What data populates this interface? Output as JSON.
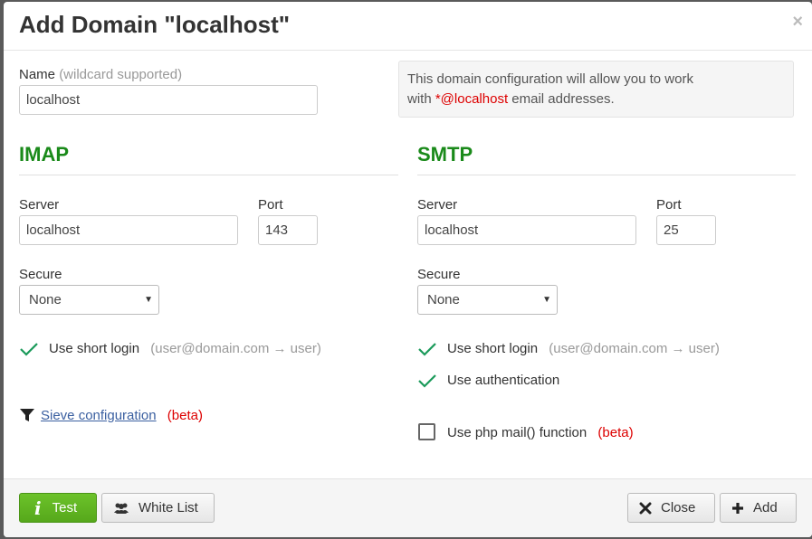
{
  "dialog": {
    "title": "Add Domain \"localhost\"",
    "close_symbol": "×"
  },
  "name_field": {
    "label": "Name",
    "hint": "(wildcard supported)",
    "value": "localhost"
  },
  "info": {
    "line1": "This domain configuration will allow you to work",
    "line2_prefix": "with ",
    "highlight": "*@localhost",
    "line2_suffix": " email addresses."
  },
  "imap": {
    "heading": "IMAP",
    "server_label": "Server",
    "server_value": "localhost",
    "port_label": "Port",
    "port_value": "143",
    "secure_label": "Secure",
    "secure_value": "None",
    "short_login_label": "Use short login",
    "short_login_hint": "(user@domain.com → user)",
    "sieve_link": "Sieve configuration",
    "sieve_beta": "(beta)"
  },
  "smtp": {
    "heading": "SMTP",
    "server_label": "Server",
    "server_value": "localhost",
    "port_label": "Port",
    "port_value": "25",
    "secure_label": "Secure",
    "secure_value": "None",
    "short_login_label": "Use short login",
    "short_login_hint": "(user@domain.com → user)",
    "auth_label": "Use authentication",
    "php_mail_label": "Use php mail() function",
    "php_mail_beta": "(beta)"
  },
  "footer": {
    "test_label": "Test",
    "whitelist_label": "White List",
    "close_label": "Close",
    "add_label": "Add"
  },
  "colors": {
    "section_heading": "#1a8a1a",
    "check": "#1a9a5a",
    "test_button": "#5fb522",
    "highlight": "#dd0000"
  },
  "icons": {
    "check": "check-icon",
    "filter": "filter-icon",
    "info": "info-icon",
    "users": "users-icon",
    "close": "close-icon",
    "plus": "plus-icon"
  }
}
